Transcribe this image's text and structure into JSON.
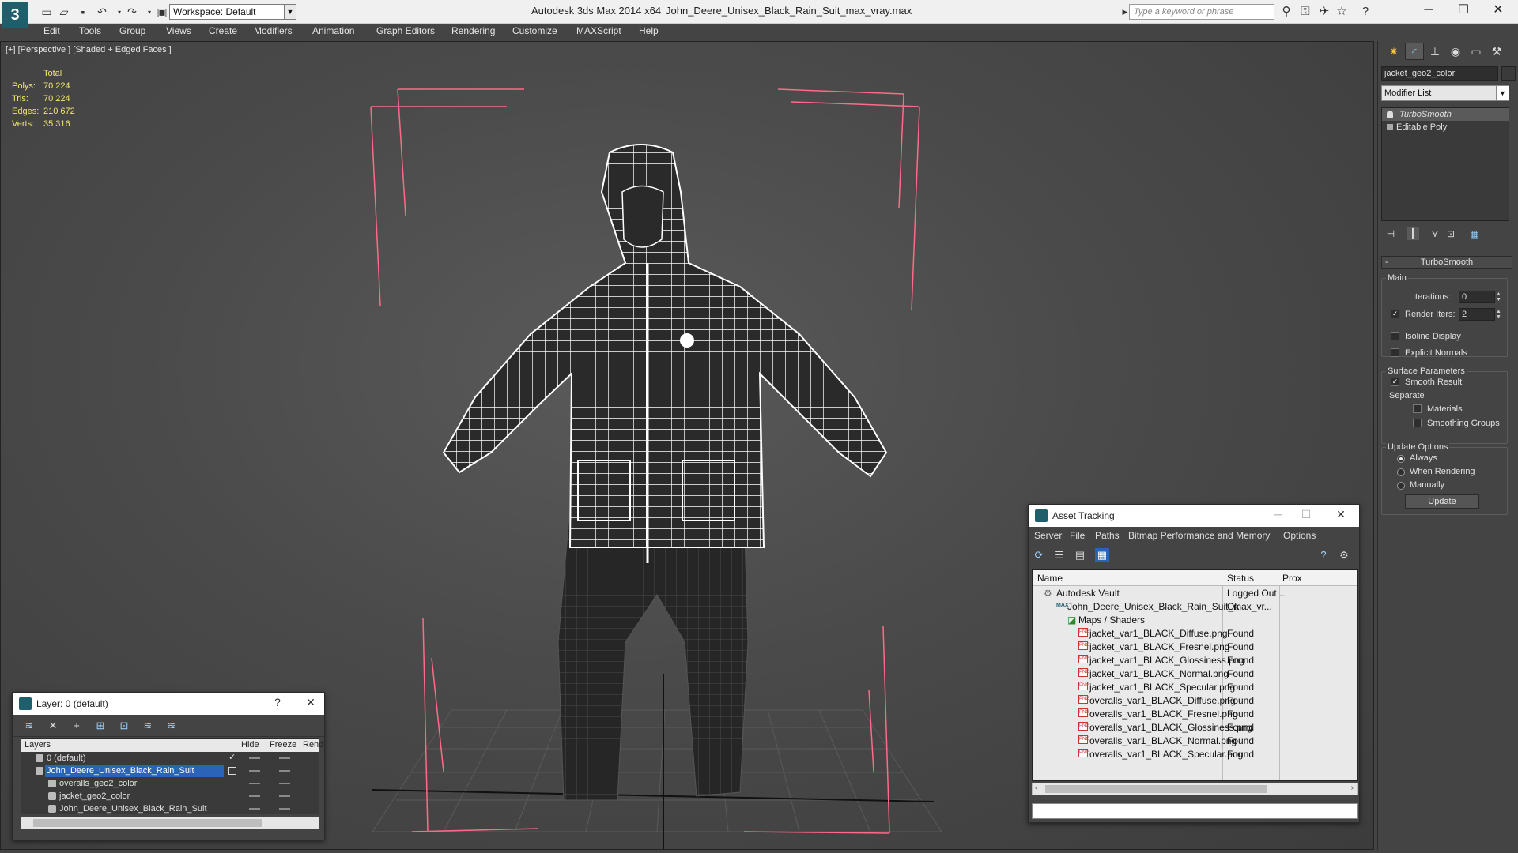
{
  "titlebar": {
    "workspace_label": "Workspace: Default",
    "app_title": "Autodesk 3ds Max  2014 x64",
    "file_name": "John_Deere_Unisex_Black_Rain_Suit_max_vray.max",
    "search_placeholder": "Type a keyword or phrase"
  },
  "menu": [
    "Edit",
    "Tools",
    "Group",
    "Views",
    "Create",
    "Modifiers",
    "Animation",
    "Graph Editors",
    "Rendering",
    "Customize",
    "MAXScript",
    "Help"
  ],
  "viewport": {
    "label": "[+] [Perspective ] [Shaded + Edged Faces ]",
    "stats": {
      "header": "Total",
      "rows": [
        {
          "label": "Polys:",
          "value": "70 224"
        },
        {
          "label": "Tris:",
          "value": "70 224"
        },
        {
          "label": "Edges:",
          "value": "210 672"
        },
        {
          "label": "Verts:",
          "value": "35 316"
        }
      ]
    }
  },
  "layer_dialog": {
    "title": "Layer: 0 (default)",
    "help": "?",
    "columns": {
      "layers": "Layers",
      "hide": "Hide",
      "freeze": "Freeze",
      "render": "Rend"
    },
    "rows": [
      {
        "name": "0 (default)"
      },
      {
        "name": "John_Deere_Unisex_Black_Rain_Suit"
      },
      {
        "name": "overalls_geo2_color"
      },
      {
        "name": "jacket_geo2_color"
      },
      {
        "name": "John_Deere_Unisex_Black_Rain_Suit"
      }
    ]
  },
  "asset_dialog": {
    "title": "Asset Tracking",
    "menu": [
      "Server",
      "File",
      "Paths",
      "Bitmap Performance and Memory",
      "Options"
    ],
    "columns": {
      "name": "Name",
      "status": "Status",
      "proxy": "Prox"
    },
    "rows": [
      {
        "name": "Autodesk Vault",
        "status": "Logged Out ..."
      },
      {
        "name": "John_Deere_Unisex_Black_Rain_Suit_max_vr...",
        "status": "Ok"
      },
      {
        "name": "Maps / Shaders",
        "status": ""
      },
      {
        "name": "jacket_var1_BLACK_Diffuse.png",
        "status": "Found"
      },
      {
        "name": "jacket_var1_BLACK_Fresnel.png",
        "status": "Found"
      },
      {
        "name": "jacket_var1_BLACK_Glossiness.png",
        "status": "Found"
      },
      {
        "name": "jacket_var1_BLACK_Normal.png",
        "status": "Found"
      },
      {
        "name": "jacket_var1_BLACK_Specular.png",
        "status": "Found"
      },
      {
        "name": "overalls_var1_BLACK_Diffuse.png",
        "status": "Found"
      },
      {
        "name": "overalls_var1_BLACK_Fresnel.png",
        "status": "Found"
      },
      {
        "name": "overalls_var1_BLACK_Glossiness.png",
        "status": "Found"
      },
      {
        "name": "overalls_var1_BLACK_Normal.png",
        "status": "Found"
      },
      {
        "name": "overalls_var1_BLACK_Specular.png",
        "status": "Found"
      }
    ],
    "png_badge": "PNG"
  },
  "command_panel": {
    "object_name": "jacket_geo2_color",
    "modifier_list": "Modifier List",
    "stack": [
      "TurboSmooth",
      "Editable Poly"
    ],
    "turbosmooth": {
      "title": "TurboSmooth",
      "main_label": "Main",
      "iterations_label": "Iterations:",
      "iterations_value": "0",
      "render_iters_label": "Render Iters:",
      "render_iters_value": "2",
      "render_iters_checked": true,
      "isoline_label": "Isoline Display",
      "explicit_normals_label": "Explicit Normals",
      "surface_label": "Surface Parameters",
      "smooth_result_label": "Smooth Result",
      "smooth_result_checked": true,
      "separate_label": "Separate",
      "materials_label": "Materials",
      "smoothing_groups_label": "Smoothing Groups",
      "update_options_label": "Update Options",
      "always_label": "Always",
      "when_rendering_label": "When Rendering",
      "manually_label": "Manually",
      "update_button": "Update"
    }
  },
  "colors": {
    "selection": "#2a63b8",
    "stats": "#f2e66a",
    "bbox": "#ff6a8a"
  }
}
